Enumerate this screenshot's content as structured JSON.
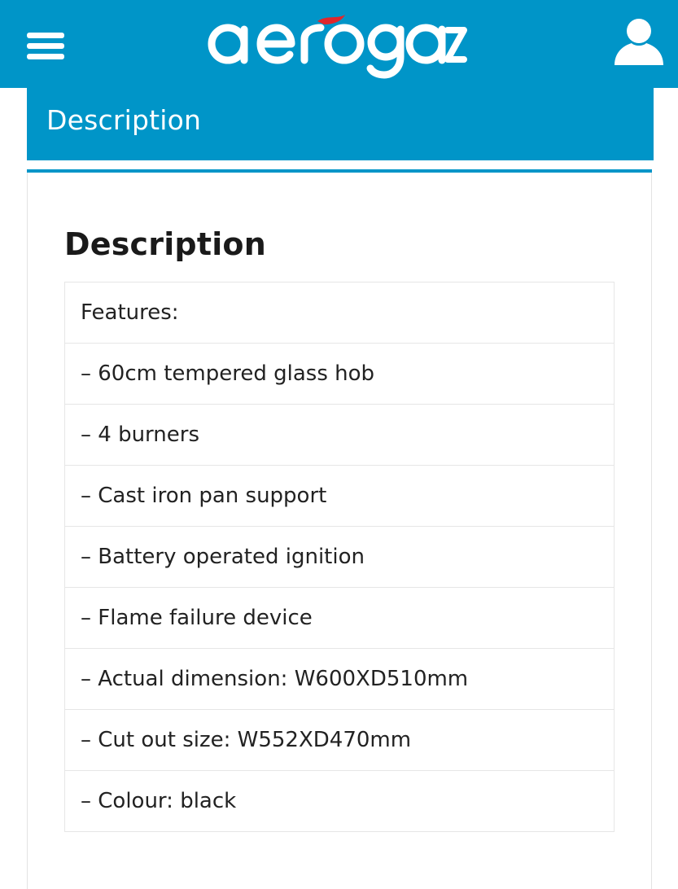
{
  "header": {
    "brand": "aerogaz",
    "brand_color": "#0095c8",
    "accent_color": "#e0262c",
    "menu_icon": "hamburger-menu-icon",
    "user_icon": "user-icon"
  },
  "tab": {
    "label": "Description"
  },
  "content": {
    "heading": "Description",
    "rows": [
      "Features:",
      "– 60cm tempered glass hob",
      "– 4 burners",
      "– Cast iron pan support",
      "– Battery operated ignition",
      "– Flame failure device",
      "– Actual dimension: W600XD510mm",
      "– Cut out size: W552XD470mm",
      "– Colour: black"
    ]
  }
}
